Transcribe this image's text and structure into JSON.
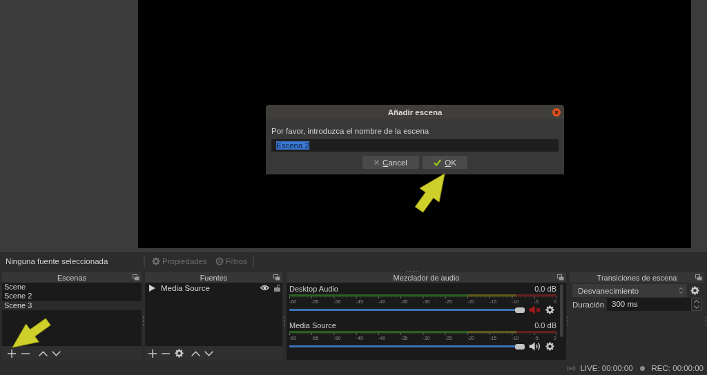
{
  "dialog": {
    "title": "Añadir escena",
    "prompt": "Por favor, introduzca el nombre de la escena",
    "input": {
      "value": "Escena 2",
      "text_selected": true
    },
    "buttons": [
      {
        "kind": "cancel",
        "label": "Cancel",
        "mnemonic_underlined": true
      },
      {
        "kind": "ok",
        "label": "OK",
        "mnemonic_underlined": true
      }
    ]
  },
  "source_bar": {
    "status": "Ninguna fuente seleccionada",
    "buttons": [
      {
        "kind": "properties",
        "label": "Propiedades",
        "disabled": true
      },
      {
        "kind": "filters",
        "label": "Filtros",
        "disabled": true
      }
    ]
  },
  "scenes": {
    "title": "Escenas",
    "items": [
      {
        "label": "Scene",
        "selected": false
      },
      {
        "label": "Scene 2",
        "selected": false
      },
      {
        "label": "Scene 3",
        "selected": true
      }
    ]
  },
  "sources": {
    "title": "Fuentes",
    "items": [
      {
        "label": "Media Source",
        "selected": false,
        "visible": true,
        "locked": false
      }
    ]
  },
  "mixer": {
    "title": "Mezclador de audio",
    "channels": [
      {
        "name": "Desktop Audio",
        "reading": "0.0 dB",
        "scale": [
          "-60",
          "-55",
          "-50",
          "-45",
          "-40",
          "-35",
          "-30",
          "-25",
          "-20",
          "-15",
          "-10",
          "-5",
          "0"
        ],
        "level": 1,
        "muted": true
      },
      {
        "name": "Media Source",
        "reading": "0.0 dB",
        "scale": [
          "-60",
          "-55",
          "-50",
          "-45",
          "-40",
          "-35",
          "-30",
          "-25",
          "-20",
          "-15",
          "-10",
          "-5",
          "0"
        ],
        "level": 1,
        "muted": false
      }
    ]
  },
  "transitions": {
    "title": "Transiciones de escena",
    "transition": {
      "value": "Desvanecimiento"
    },
    "duration": {
      "label": "Duración",
      "value": "300 ms"
    }
  },
  "status_bar": {
    "live": "LIVE: 00:00:00",
    "rec": "REC: 00:00:00"
  }
}
